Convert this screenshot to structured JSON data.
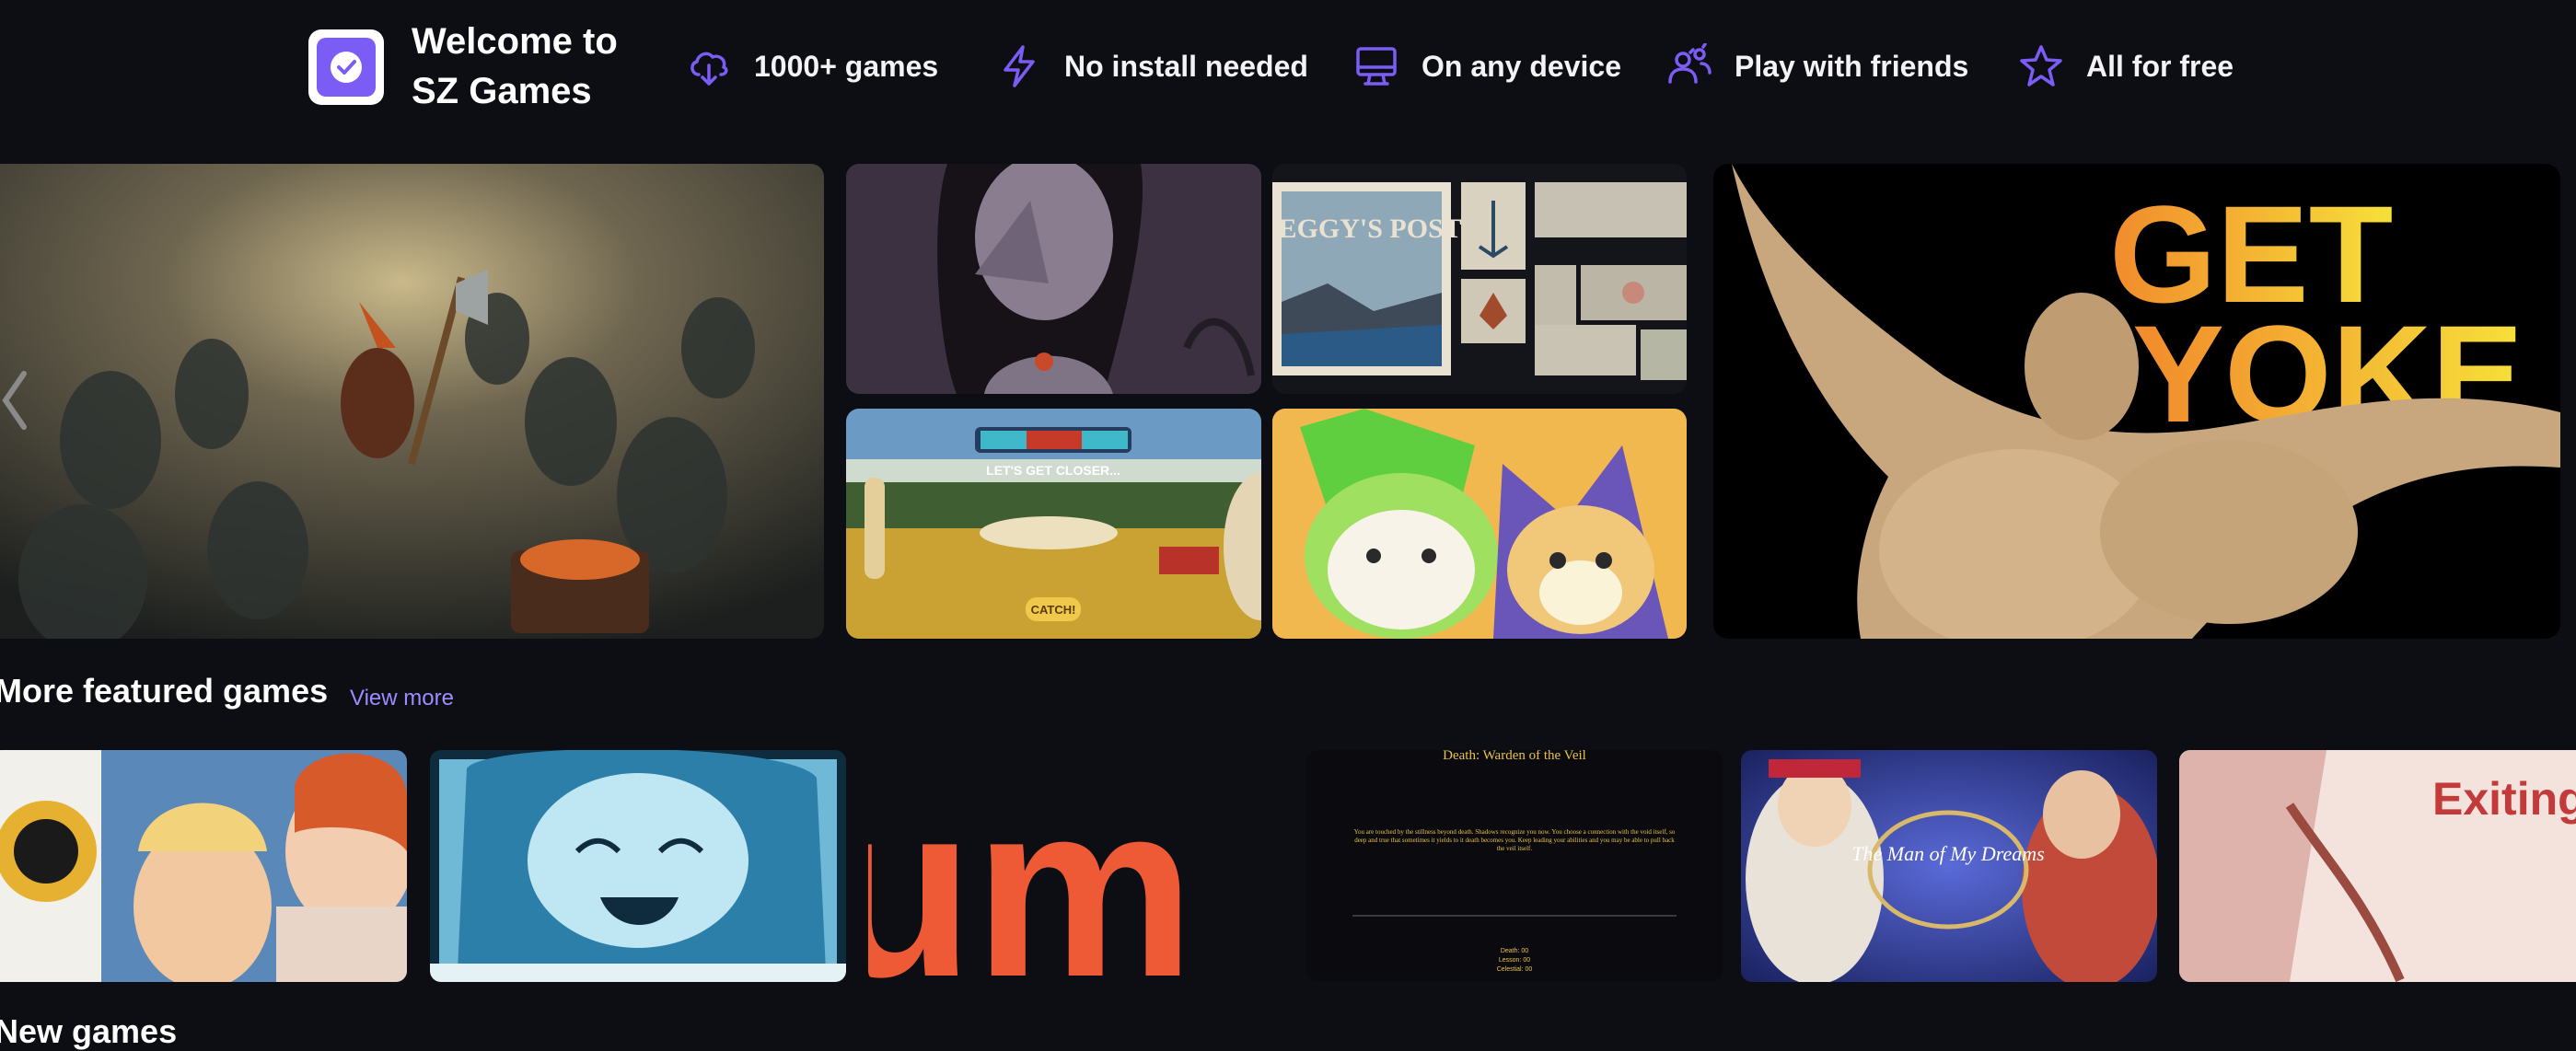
{
  "header": {
    "welcome": "Welcome to SZ Games",
    "logo_icon": "check-badge-icon",
    "features": [
      {
        "icon": "cloud-download-icon",
        "label": "1000+ games"
      },
      {
        "icon": "lightning-icon",
        "label": "No install needed"
      },
      {
        "icon": "monitor-icon",
        "label": "On any device"
      },
      {
        "icon": "friends-icon",
        "label": "Play with friends"
      },
      {
        "icon": "star-icon",
        "label": "All for free"
      }
    ],
    "accent": "#7b5cf5"
  },
  "hero": {
    "tiles": [
      {
        "name": "dwarf-goblins-art"
      },
      {
        "name": "crying-girl-art"
      },
      {
        "name": "peggys-post",
        "text": "PEGGY'S POST"
      },
      {
        "name": "lets-get-closer",
        "text": "LET'S GET CLOSER...",
        "button": "CATCH!"
      },
      {
        "name": "cute-creatures-art"
      },
      {
        "name": "get-yoke",
        "text_line1": "GET",
        "text_line2": "YOKE"
      }
    ]
  },
  "featured": {
    "title": "More featured games",
    "view_more": "View more",
    "cards": [
      {
        "name": "anime-adventure-card"
      },
      {
        "name": "pixel-anime-girl-card"
      },
      {
        "name": "orange-um-card",
        "text": "um"
      },
      {
        "name": "death-warden-card",
        "title": "Death: Warden of the Veil",
        "body": "You are touched by the stillness beyond death. Shadows recognize you now. You choose a connection with the void itself, so deep and true that sometimes it yields to it death becomes you. Keep leading your abilities and you may be able to pull back the veil itself.",
        "stats": [
          "Death: 00",
          "Lesson: 00",
          "Celestial: 00"
        ]
      },
      {
        "name": "man-of-my-dreams-card",
        "title": "The Man of My Dreams"
      },
      {
        "name": "exiting-white-room-card",
        "text": "Exiting White Room"
      }
    ]
  },
  "next_section": {
    "title": "New games"
  }
}
